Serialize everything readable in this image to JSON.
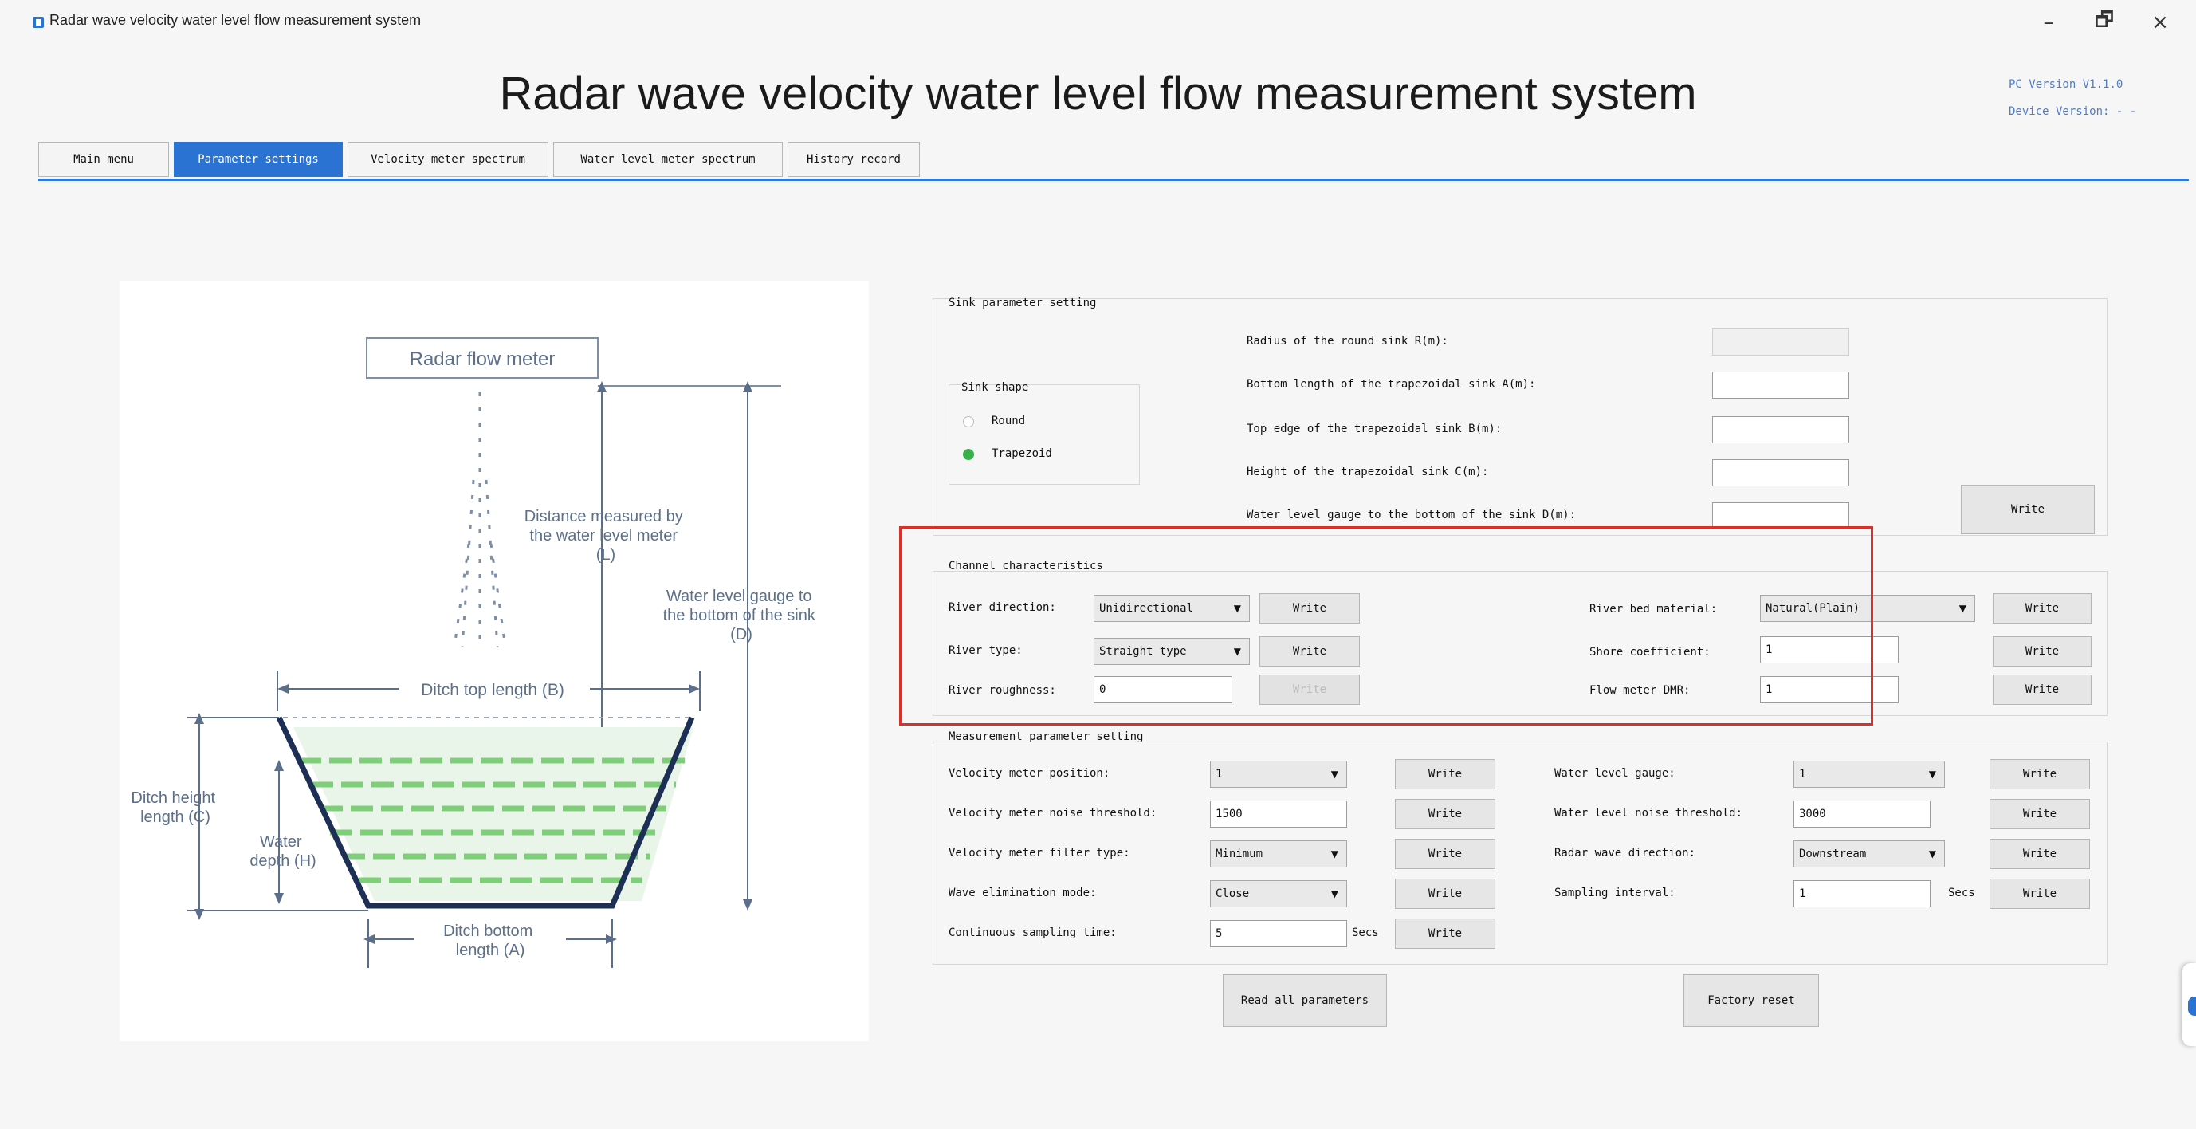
{
  "window": {
    "title": "Radar wave velocity water level flow measurement system",
    "controls": {
      "minimize": "–",
      "maximize": "🗗",
      "close": "×"
    }
  },
  "header": {
    "title": "Radar wave velocity water level flow measurement system",
    "pc_version": "PC Version V1.1.0",
    "device_version": "Device Version: - -"
  },
  "tabs": [
    "Main menu",
    "Parameter settings",
    "Velocity meter spectrum",
    "Water level meter spectrum",
    "History record"
  ],
  "diagram": {
    "radar_label": "Radar flow meter",
    "distance_label": [
      "Distance measured by",
      "the water level meter",
      "(L)"
    ],
    "gauge_label": [
      "Water level gauge to",
      "the bottom of the sink",
      "(D)"
    ],
    "top_length": "Ditch top length (B)",
    "height": [
      "Ditch height",
      "length (C)"
    ],
    "water_depth": [
      "Water",
      "depth (H)"
    ],
    "bottom_length": [
      "Ditch bottom",
      "length (A)"
    ]
  },
  "sink": {
    "title": "Sink parameter setting",
    "shape_title": "Sink shape",
    "shape_options": [
      "Round",
      "Trapezoid"
    ],
    "selected_shape": "Trapezoid",
    "labels": [
      "Radius of the round sink R(m):",
      "Bottom length of the trapezoidal sink A(m):",
      "Top edge of the trapezoidal sink B(m):",
      "Height of the trapezoidal sink C(m):",
      "Water level gauge to the bottom of the sink D(m):"
    ],
    "values": [
      "",
      "",
      "",
      "",
      ""
    ],
    "write": "Write"
  },
  "channel": {
    "title": "Channel characteristics",
    "river_direction_label": "River direction:",
    "river_direction_value": "Unidirectional",
    "river_type_label": "River type:",
    "river_type_value": "Straight type",
    "river_roughness_label": "River roughness:",
    "river_roughness_value": "0",
    "bed_material_label": "River bed material:",
    "bed_material_value": "Natural(Plain)",
    "shore_coefficient_label": "Shore coefficient:",
    "shore_coefficient_value": "1",
    "flow_meter_dmr_label": "Flow meter DMR:",
    "flow_meter_dmr_value": "1",
    "write": "Write"
  },
  "measurement": {
    "title": "Measurement parameter setting",
    "velocity_position_label": "Velocity meter position:",
    "velocity_position_value": "1",
    "velocity_noise_label": "Velocity meter noise threshold:",
    "velocity_noise_value": "1500",
    "velocity_filter_label": "Velocity meter filter type:",
    "velocity_filter_value": "Minimum",
    "wave_elimination_label": "Wave elimination mode:",
    "wave_elimination_value": "Close",
    "continuous_sampling_label": "Continuous sampling time:",
    "continuous_sampling_value": "5",
    "water_gauge_label": "Water level gauge:",
    "water_gauge_value": "1",
    "water_noise_label": "Water level noise threshold:",
    "water_noise_value": "3000",
    "radar_direction_label": "Radar wave direction:",
    "radar_direction_value": "Downstream",
    "sampling_interval_label": "Sampling interval:",
    "sampling_interval_value": "1",
    "unit_secs": "Secs",
    "write": "Write"
  },
  "actions": {
    "read_all": "Read all parameters",
    "factory_reset": "Factory reset"
  },
  "colors": {
    "accent": "#2b73d2",
    "highlight": "#d9302a",
    "radio_selected": "#39b14a",
    "water": "#7fcf7a"
  }
}
